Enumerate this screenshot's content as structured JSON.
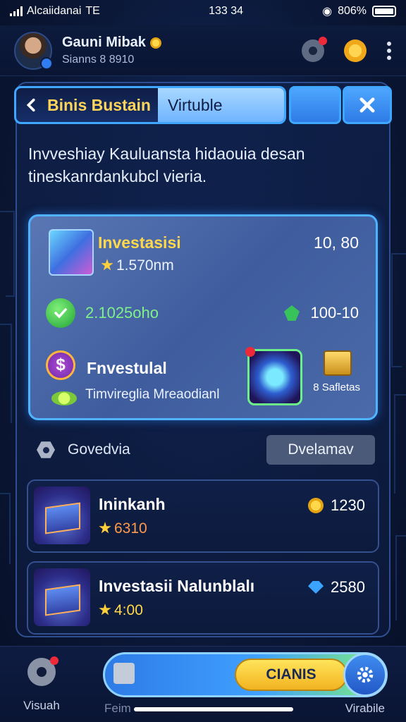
{
  "status_bar": {
    "carrier": "Alcaiidanai",
    "network": "TE",
    "time": "133 34",
    "battery": "806%"
  },
  "header": {
    "user_name": "Gauni Mibak",
    "user_sub": "Sianns 8 8910"
  },
  "tabs": {
    "primary_label": "Binis Bustain",
    "secondary_label": "Virtuble"
  },
  "description": "Invveshiay Kauluansta hidaouia desan tineskanrdankubcl vieria.",
  "invest_card": {
    "title": "Investasisi",
    "top_value": "10, 80",
    "sub_value": "1.570nm",
    "green_value": "2.1025oho",
    "range_value": "100-10",
    "name": "Fnvestulal",
    "name_desc": "Timvireglia Mreaodianl",
    "small_label": "8 Safletas",
    "dollar_symbol": "$"
  },
  "section": {
    "title": "Govedvia",
    "button_label": "Dvelamav"
  },
  "list": [
    {
      "title": "Ininkanh",
      "title_suffix": "",
      "rating": "6310",
      "value": "1230",
      "value_icon": "gold-coin"
    },
    {
      "title": "Investasii",
      "title_suffix": " Nalunblalı",
      "rating": "4:00",
      "value": "2580",
      "value_icon": "blue-gem"
    }
  ],
  "bottom_nav": {
    "left_label": "Visuah",
    "mid_label": "Feim",
    "right_label": "Virabile",
    "claim_label": "CIANIS"
  },
  "colors": {
    "accent": "#3fa7ff",
    "gold": "#ffd84a",
    "background": "#0b1838"
  }
}
